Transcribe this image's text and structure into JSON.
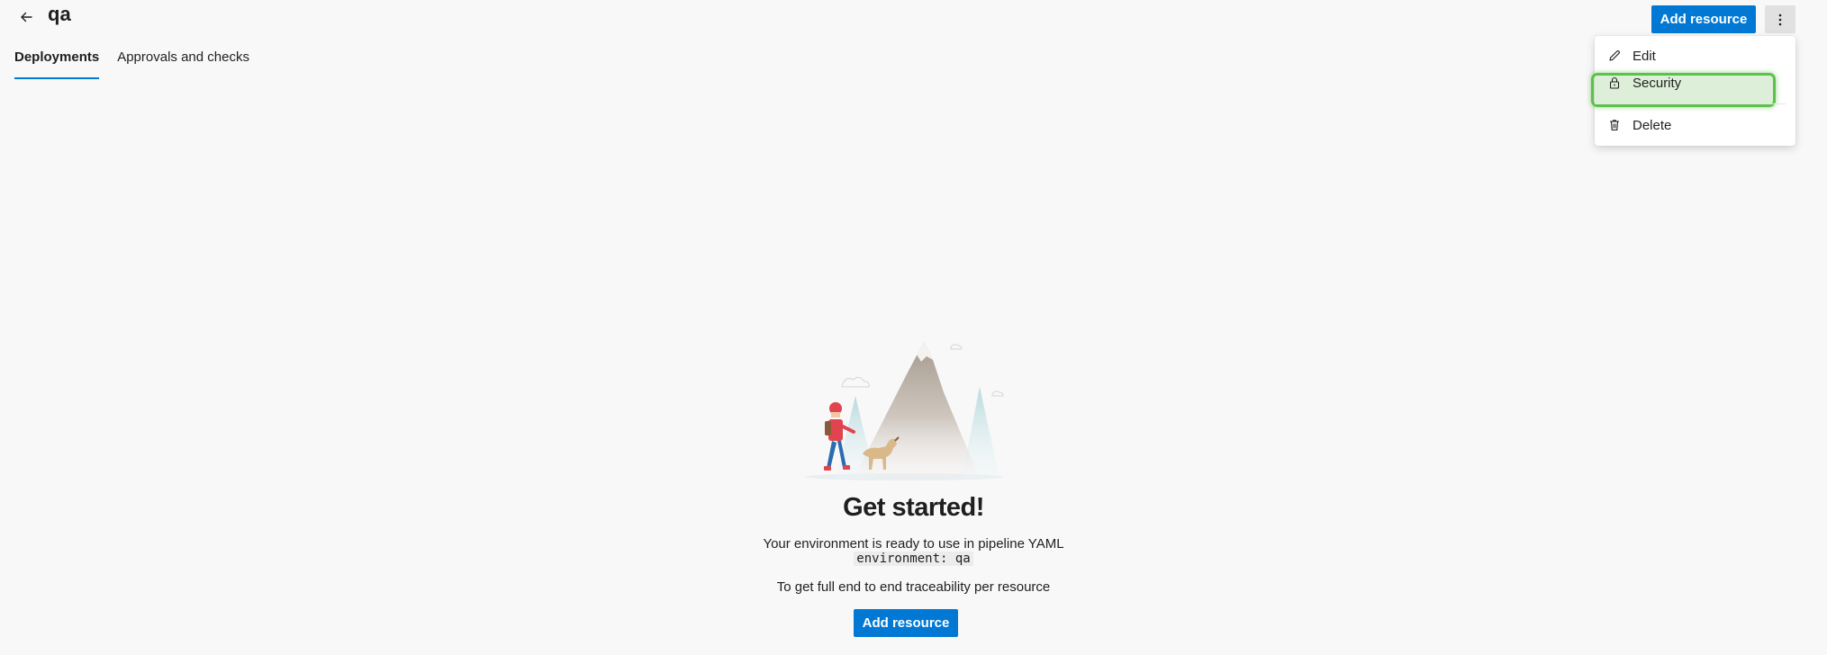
{
  "header": {
    "title": "qa",
    "add_resource_label": "Add resource"
  },
  "tabs": [
    {
      "label": "Deployments",
      "active": true
    },
    {
      "label": "Approvals and checks",
      "active": false
    }
  ],
  "menu": {
    "items": [
      {
        "label": "Edit",
        "icon": "pencil-icon"
      },
      {
        "label": "Security",
        "icon": "lock-icon",
        "highlighted": true
      },
      {
        "label": "Delete",
        "icon": "trash-icon"
      }
    ]
  },
  "empty_state": {
    "heading": "Get started!",
    "description": "Your environment is ready to use in pipeline YAML",
    "code": "environment: qa",
    "traceability_text": "To get full end to end traceability per resource",
    "button_label": "Add resource"
  },
  "colors": {
    "accent": "#0078d4",
    "highlight": "#5cc34a",
    "background": "#f8f8f8"
  }
}
